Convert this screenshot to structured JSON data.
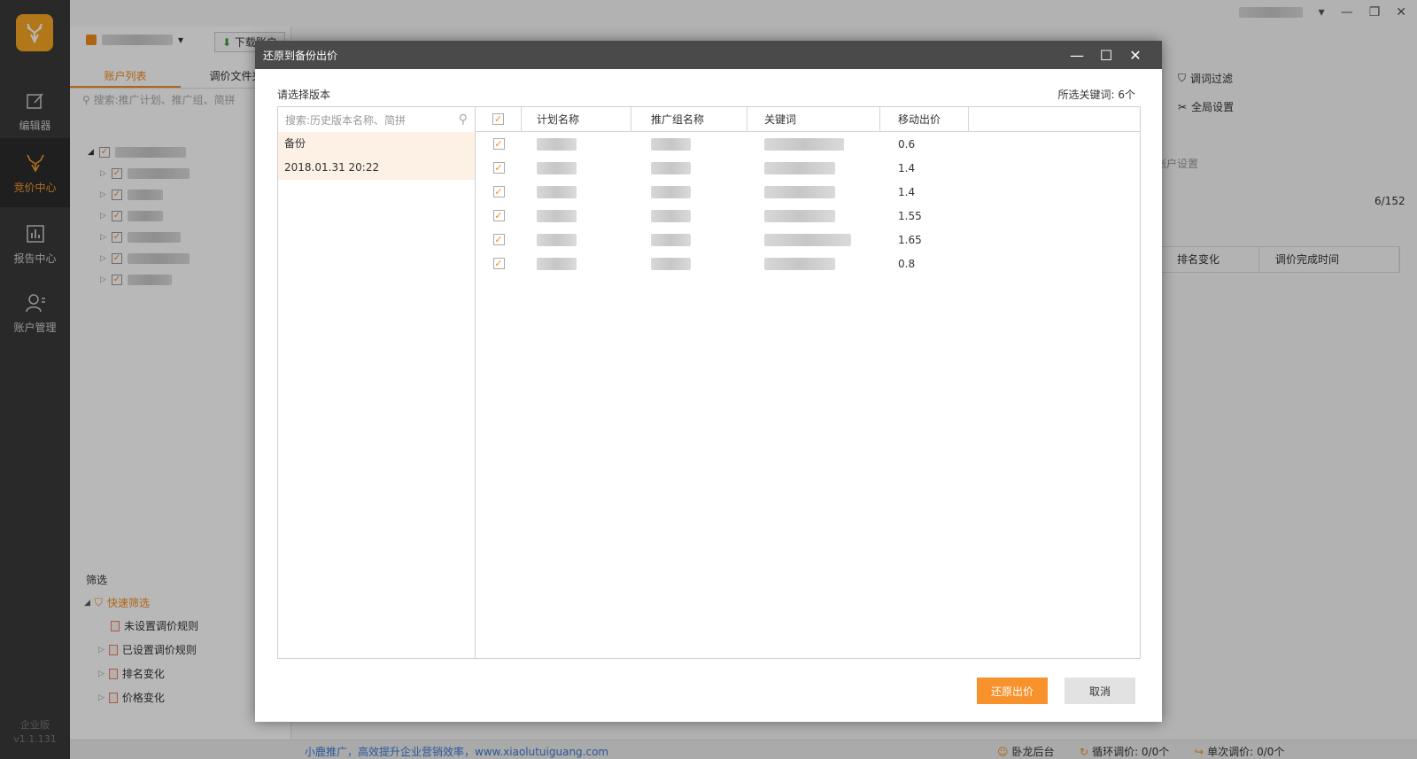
{
  "nav": {
    "items": [
      {
        "label": "编辑器",
        "icon": "edit-icon"
      },
      {
        "label": "竞价中心",
        "icon": "deer-icon"
      },
      {
        "label": "报告中心",
        "icon": "bar-chart-icon"
      },
      {
        "label": "账户管理",
        "icon": "user-icon"
      }
    ],
    "edition": "企业版",
    "version": "v1.1.131"
  },
  "background": {
    "download_label": "下载账户",
    "tabs": [
      "账户列表",
      "调价文件夹"
    ],
    "search_placeholder": "搜索:推广计划、推广组、简拼",
    "filter_title": "筛选",
    "quick_filter": "快速筛选",
    "filters": [
      "未设置调价规则",
      "已设置调价规则",
      "排名变化",
      "价格变化"
    ],
    "links": [
      "调词过滤",
      "全局设置"
    ],
    "account_settings": "账户设置",
    "count": "6/152",
    "grid_cols": [
      "排名变化",
      "调价完成时间"
    ]
  },
  "statusbar": {
    "slogan": "小鹿推广，高效提升企业营销效率，www.xiaolutuiguang.com",
    "backend": "卧龙后台",
    "cycle_label": "循环调价: 0/0个",
    "single_label": "单次调价:",
    "single_value": "0/0个"
  },
  "dialog": {
    "title": "还原到备份出价",
    "select_version_label": "请选择版本",
    "selected_keywords": "所选关键词: 6个",
    "search_placeholder": "搜索:历史版本名称、简拼",
    "versions": [
      "备份",
      "2018.01.31 20:22"
    ],
    "columns": [
      "计划名称",
      "推广组名称",
      "关键词",
      "移动出价"
    ],
    "rows": [
      {
        "price": "0.6"
      },
      {
        "price": "1.4"
      },
      {
        "price": "1.4"
      },
      {
        "price": "1.55"
      },
      {
        "price": "1.65"
      },
      {
        "price": "0.8"
      }
    ],
    "confirm_label": "还原出价",
    "cancel_label": "取消"
  },
  "colors": {
    "accent": "#f7922d",
    "nav_bg": "#3a3a3a",
    "dialog_title_bg": "#4a4a4a",
    "selected_row": "#fdf1e6"
  }
}
